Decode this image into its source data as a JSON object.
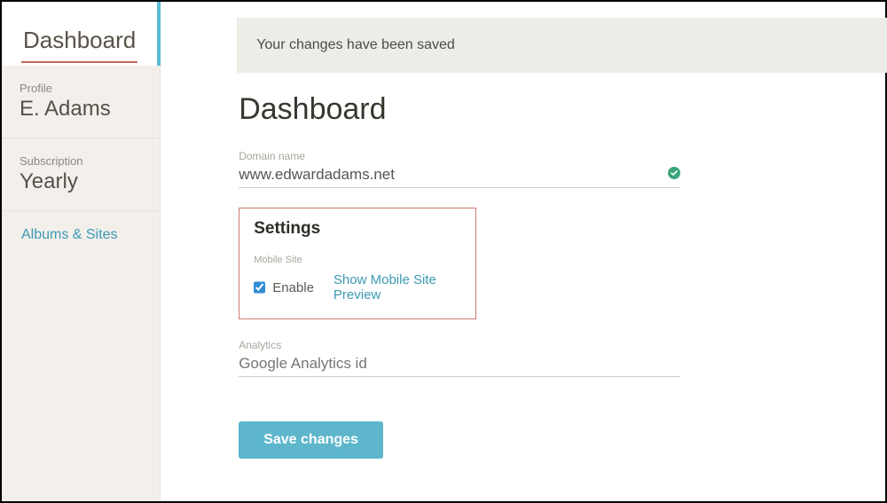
{
  "sidebar": {
    "tab_title": "Dashboard",
    "profile": {
      "label": "Profile",
      "value": "E. Adams"
    },
    "subscription": {
      "label": "Subscription",
      "value": "Yearly"
    },
    "albums_link": "Albums & Sites"
  },
  "flash_message": "Your changes have been saved",
  "page_title": "Dashboard",
  "domain": {
    "label": "Domain name",
    "value": "www.edwardadams.net"
  },
  "settings": {
    "title": "Settings",
    "subtitle": "Mobile Site",
    "enable_label": "Enable",
    "enable_checked": true,
    "preview_link": "Show Mobile Site Preview"
  },
  "analytics": {
    "label": "Analytics",
    "placeholder": "Google Analytics id"
  },
  "save_button": "Save changes",
  "colors": {
    "accent": "#5db6cc",
    "link": "#3c99b3",
    "highlight_border": "#d07a70",
    "active_tab_border": "#58bcd6",
    "underline": "#c4695b"
  }
}
